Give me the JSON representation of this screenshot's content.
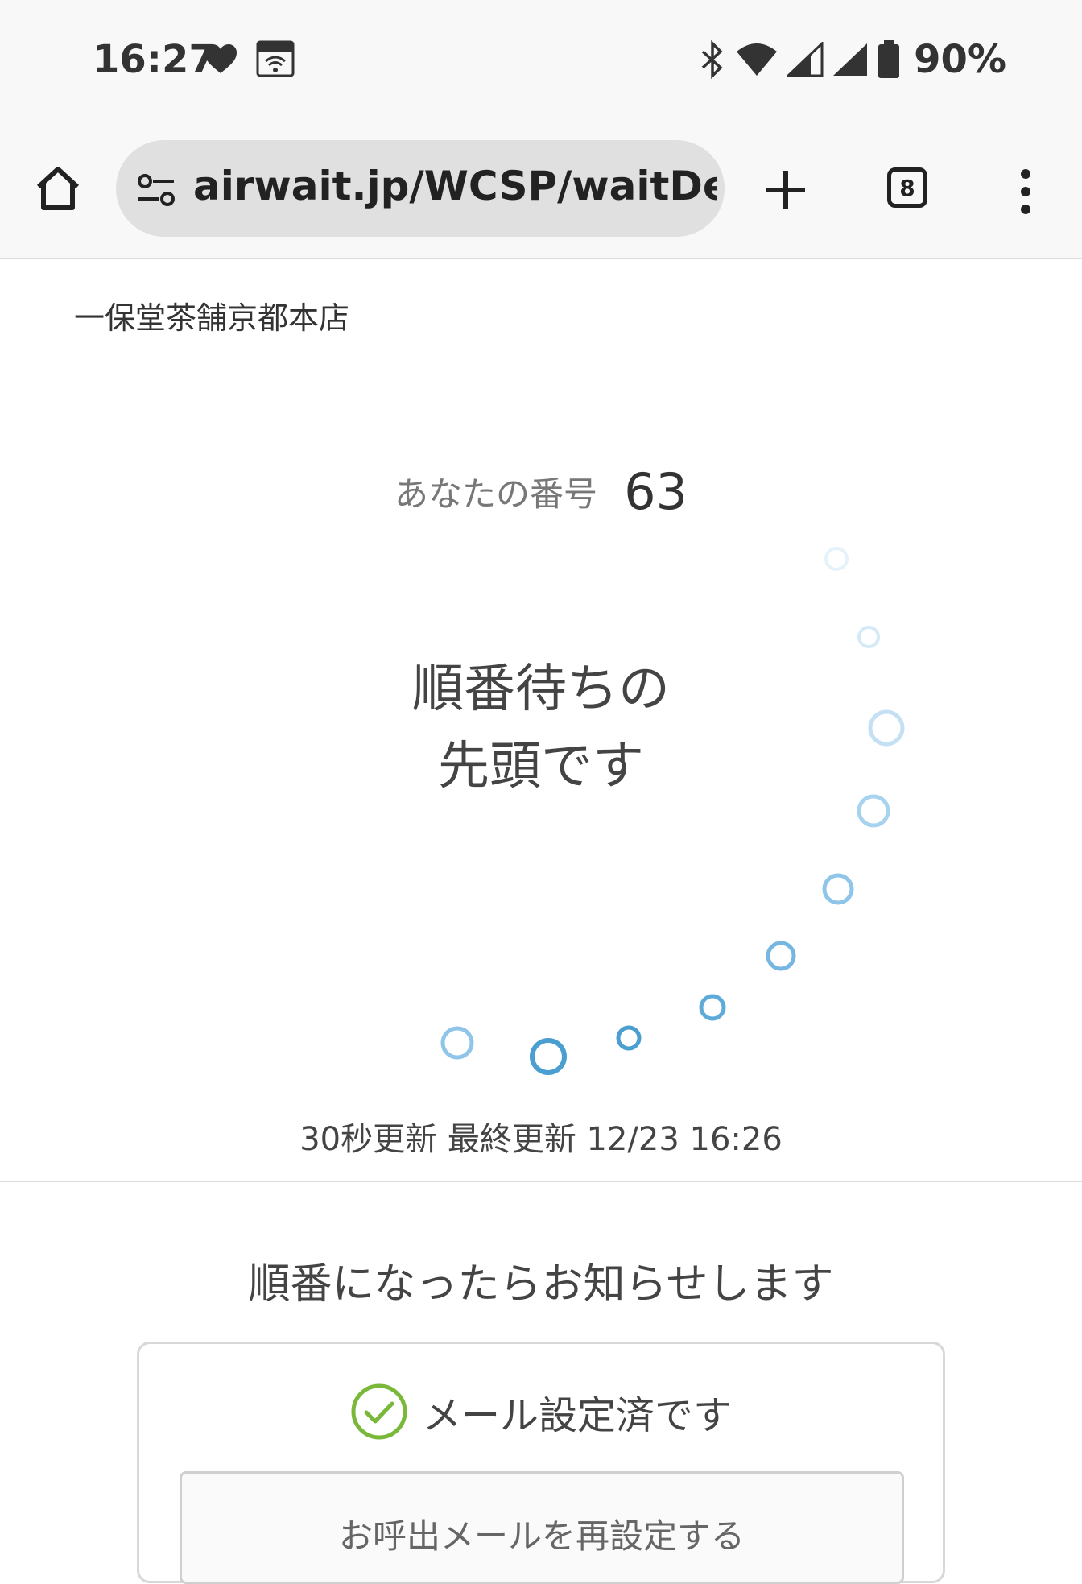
{
  "status_bar": {
    "time": "16:27",
    "battery": "90%",
    "icons": [
      "heart-icon",
      "au-wifi-icon",
      "bluetooth-icon",
      "wifi-icon",
      "signal-icon",
      "signal-icon",
      "battery-icon"
    ]
  },
  "browser": {
    "url": "airwait.jp/WCSP/waitDetai",
    "tab_count": "8"
  },
  "page": {
    "store_name": "一保堂茶舗京都本店",
    "number_label": "あなたの番号",
    "number_value": "63",
    "status_line1": "順番待ちの",
    "status_line2": "先頭です",
    "update_info": "30秒更新 最終更新 12/23 16:26",
    "notify_message": "順番になったらお知らせします",
    "mail_status": "メール設定済です",
    "reset_button": "お呼出メールを再設定する"
  },
  "colors": {
    "accent_blue": "#4a9fd0",
    "check_green": "#7ab83a"
  }
}
